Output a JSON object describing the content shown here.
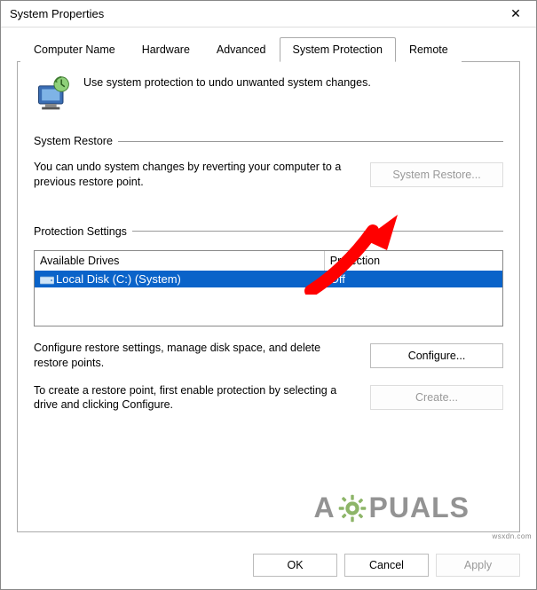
{
  "window": {
    "title": "System Properties"
  },
  "tabs": [
    "Computer Name",
    "Hardware",
    "Advanced",
    "System Protection",
    "Remote"
  ],
  "active_tab_index": 3,
  "intro": "Use system protection to undo unwanted system changes.",
  "restore_group": {
    "label": "System Restore",
    "text": "You can undo system changes by reverting your computer to a previous restore point.",
    "button": "System Restore..."
  },
  "protection_group": {
    "label": "Protection Settings",
    "columns": [
      "Available Drives",
      "Protection"
    ],
    "rows": [
      {
        "name": "Local Disk (C:) (System)",
        "protection": "Off",
        "selected": true
      }
    ],
    "configure_text": "Configure restore settings, manage disk space, and delete restore points.",
    "configure_button": "Configure...",
    "create_text": "To create a restore point, first enable protection by selecting a drive and clicking Configure.",
    "create_button": "Create..."
  },
  "footer": {
    "ok": "OK",
    "cancel": "Cancel",
    "apply": "Apply"
  },
  "watermark": "wsxdn.com",
  "logo": "A  PUALS"
}
